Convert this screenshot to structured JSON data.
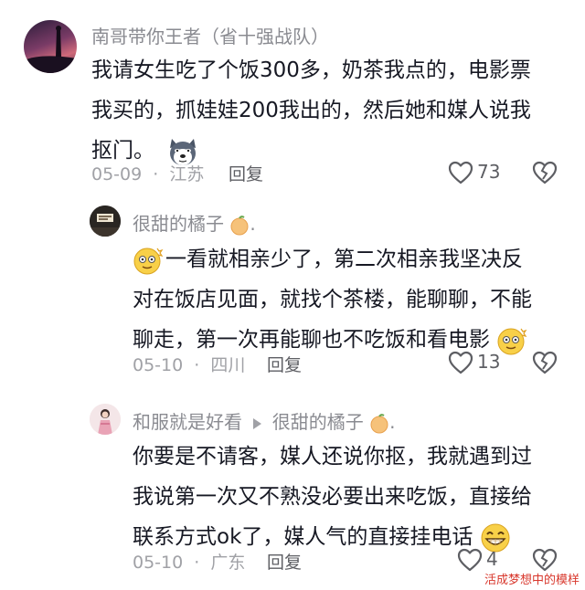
{
  "comments": [
    {
      "author": "南哥带你王者（省十强战队）",
      "lines": [
        "我请女生吃了个饭300多，奶茶我点的，电影票",
        "我买的，抓娃娃200我出的，然后她和媒人说我",
        "抠门。"
      ],
      "date": "05-09",
      "location": "江苏",
      "reply_label": "回复",
      "likes": "73"
    },
    {
      "author": "很甜的橘子",
      "lines": [
        "一看就相亲少了，第二次相亲我坚决反",
        "对在饭店见面，就找个茶楼，能聊聊，不能",
        "聊走，第一次再能聊也不吃饭和看电影"
      ],
      "date": "05-10",
      "location": "四川",
      "reply_label": "回复",
      "likes": "13"
    },
    {
      "author": "和服就是好看",
      "reply_to": "很甜的橘子",
      "lines": [
        "你要是不请客，媒人还说你抠，我就遇到过",
        "我说第一次又不熟没必要出来吃饭，直接给",
        "联系方式ok了，媒人气的直接挂电话"
      ],
      "date": "05-10",
      "location": "广东",
      "reply_label": "回复",
      "likes": "4"
    }
  ],
  "meta_separator": "·",
  "trailing_dot": ".",
  "watermark": "活成梦想中的模样",
  "colors": {
    "text": "#161823",
    "meta": "#a0a1a6",
    "name": "#8a8b91",
    "watermark": "#d8372c"
  },
  "icons": [
    "like-heart-icon",
    "dislike-broken-heart-icon",
    "husky-emoji-icon",
    "dizzy-emoji-icon",
    "grin-emoji-icon",
    "orange-emoji-icon",
    "reply-arrow-icon"
  ]
}
